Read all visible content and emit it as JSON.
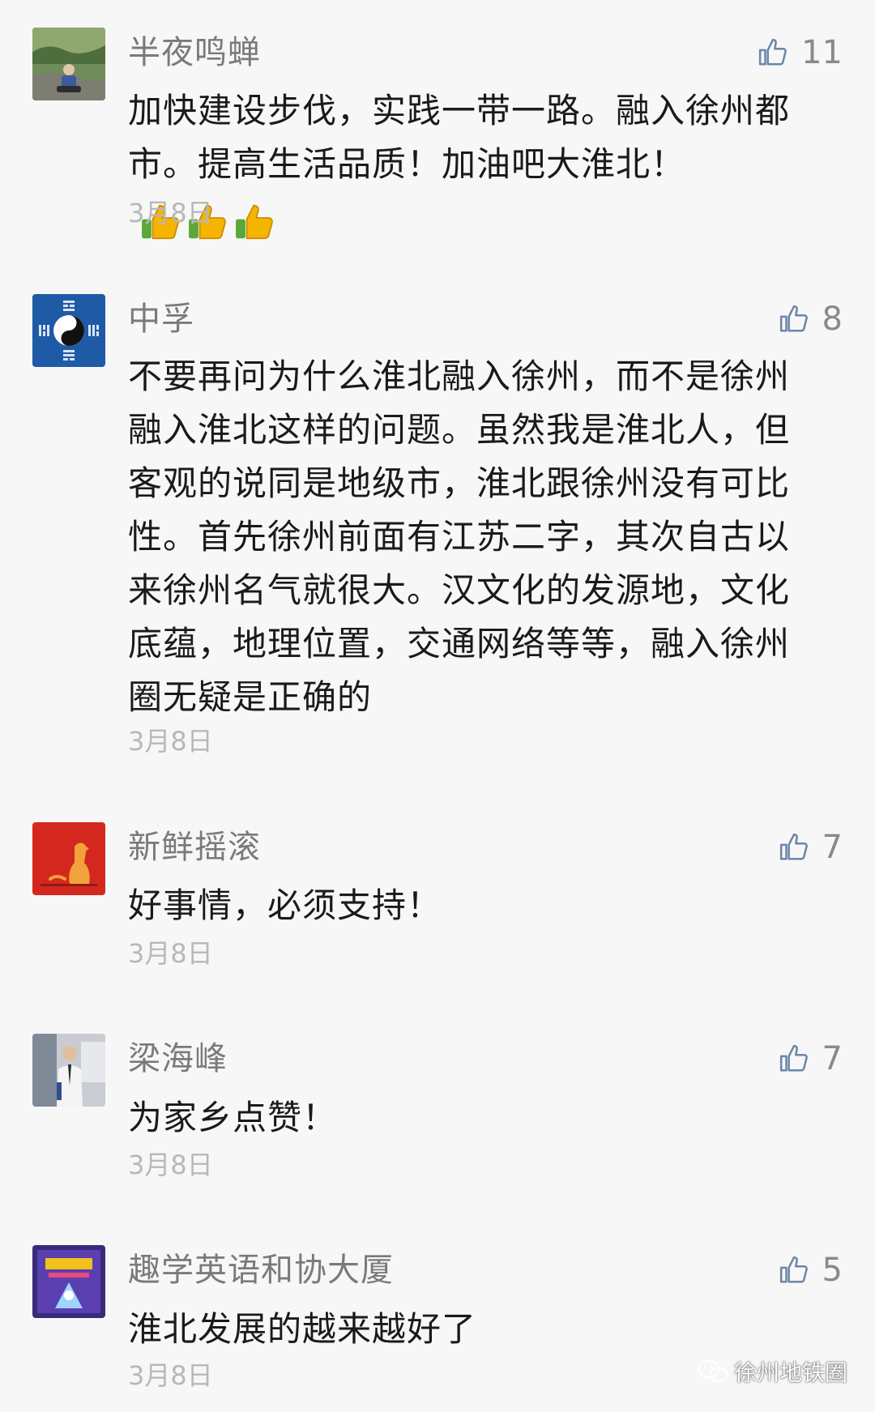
{
  "comments": [
    {
      "nickname": "半夜鸣蝉",
      "likes": "11",
      "text": "加快建设步伐，实践一带一路。融入徐州都市。提高生活品质！加油吧大淮北！",
      "emoji": [
        "thumbs-up",
        "thumbs-up",
        "thumbs-up"
      ],
      "date": "3月8日"
    },
    {
      "nickname": "中孚",
      "likes": "8",
      "text": "不要再问为什么淮北融入徐州，而不是徐州融入淮北这样的问题。虽然我是淮北人，但客观的说同是地级市，淮北跟徐州没有可比性。首先徐州前面有江苏二字，其次自古以来徐州名气就很大。汉文化的发源地，文化底蕴，地理位置，交通网络等等，融入徐州圈无疑是正确的",
      "date": "3月8日"
    },
    {
      "nickname": "新鲜摇滚",
      "likes": "7",
      "text": "好事情，必须支持！",
      "date": "3月8日"
    },
    {
      "nickname": "梁海峰",
      "likes": "7",
      "text": "为家乡点赞！",
      "date": "3月8日"
    },
    {
      "nickname": "趣学英语和协大厦",
      "likes": "5",
      "text": "淮北发展的越来越好了",
      "date": "3月8日"
    }
  ],
  "watermark": {
    "text": "徐州地铁圈",
    "icon": "wechat-icon"
  },
  "colors": {
    "background": "#f7f7f7",
    "nickname": "#7a7a7a",
    "body_text": "#1a1a1a",
    "date": "#b8b8b8",
    "like_icon": "#6b87a8"
  }
}
